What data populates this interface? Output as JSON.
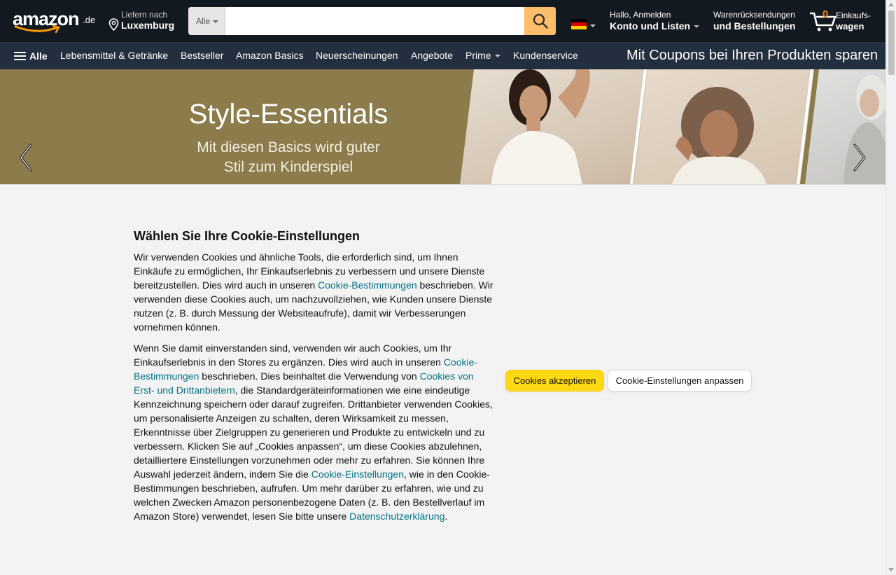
{
  "header": {
    "logo": {
      "word": "amazon",
      "tld": ".de"
    },
    "deliver": {
      "line1": "Liefern nach",
      "line2": "Luxemburg",
      "icon": "location-pin-icon"
    },
    "search": {
      "category": "Alle",
      "placeholder": "",
      "value": "",
      "icon": "search-icon"
    },
    "language": {
      "flag": "de-flag-icon",
      "colors": [
        "#000000",
        "#dd0000",
        "#ffce00"
      ]
    },
    "account": {
      "line1": "Hallo, Anmelden",
      "line2": "Konto und Listen"
    },
    "returns": {
      "line1": "Warenrücksendungen",
      "line2": "und Bestellungen"
    },
    "cart": {
      "count": "0",
      "line1": "Einkaufs-",
      "line2": "wagen",
      "icon": "cart-icon"
    }
  },
  "nav": {
    "all_label": "Alle",
    "items": [
      {
        "label": "Lebensmittel & Getränke"
      },
      {
        "label": "Bestseller"
      },
      {
        "label": "Amazon Basics"
      },
      {
        "label": "Neuerscheinungen"
      },
      {
        "label": "Angebote"
      },
      {
        "label": "Prime"
      },
      {
        "label": "Kundenservice"
      }
    ],
    "promo": "Mit Coupons bei Ihren Produkten sparen"
  },
  "hero": {
    "title": "Style-Essentials",
    "subtitle_line1": "Mit diesen Basics wird guter",
    "subtitle_line2": "Stil zum Kinderspiel",
    "prev_icon": "chevron-left-icon",
    "next_icon": "chevron-right-icon"
  },
  "cookie": {
    "heading": "Wählen Sie Ihre Cookie-Einstellungen",
    "p1": {
      "t1": "Wir verwenden Cookies und ähnliche Tools, die erforderlich sind, um Ihnen Einkäufe zu ermöglichen, Ihr Einkaufserlebnis zu verbessern und unsere Dienste bereitzustellen. Dies wird auch in unseren ",
      "link1": "Cookie-Bestimmungen",
      "t2": " beschrieben. Wir verwenden diese Cookies auch, um nachzuvollziehen, wie Kunden unsere Dienste nutzen (z. B. durch Messung der Websiteaufrufe), damit wir Verbesserungen vornehmen können."
    },
    "p2": {
      "t1": "Wenn Sie damit einverstanden sind, verwenden wir auch Cookies, um Ihr Einkaufserlebnis in den Stores zu ergänzen. Dies wird auch in unseren ",
      "link1": "Cookie-Bestimmungen",
      "t2": " beschrieben. Dies beinhaltet die Verwendung von ",
      "link2": "Cookies von Erst- und Drittanbietern",
      "t3": ", die Standardgeräteinformationen wie eine eindeutige Kennzeichnung speichern oder darauf zugreifen. Drittanbieter verwenden Cookies, um personalisierte Anzeigen zu schalten, deren Wirksamkeit zu messen, Erkenntnisse über Zielgruppen zu generieren und Produkte zu entwickeln und zu verbessern. Klicken Sie auf „Cookies anpassen“, um diese Cookies abzulehnen, detailliertere Einstellungen vorzunehmen oder mehr zu erfahren. Sie können Ihre Auswahl jederzeit ändern, indem Sie die ",
      "link3": "Cookie-Einstellungen",
      "t4": ", wie in den Cookie-Bestimmungen beschrieben, aufrufen. Um mehr darüber zu erfahren, wie und zu welchen Zwecken Amazon personenbezogene Daten (z. B. den Bestellverlauf im Amazon Store) verwendet, lesen Sie bitte unsere ",
      "link4": "Datenschutzerklärung",
      "t5": "."
    },
    "accept_label": "Cookies akzeptieren",
    "customize_label": "Cookie-Einstellungen anpassen"
  },
  "colors": {
    "header_bg": "#131921",
    "nav_bg": "#232f3e",
    "search_button": "#febd69",
    "accept_button": "#ffd814",
    "link": "#007185",
    "hero_bg": "#8c7b4b",
    "cart_count": "#f08804"
  }
}
